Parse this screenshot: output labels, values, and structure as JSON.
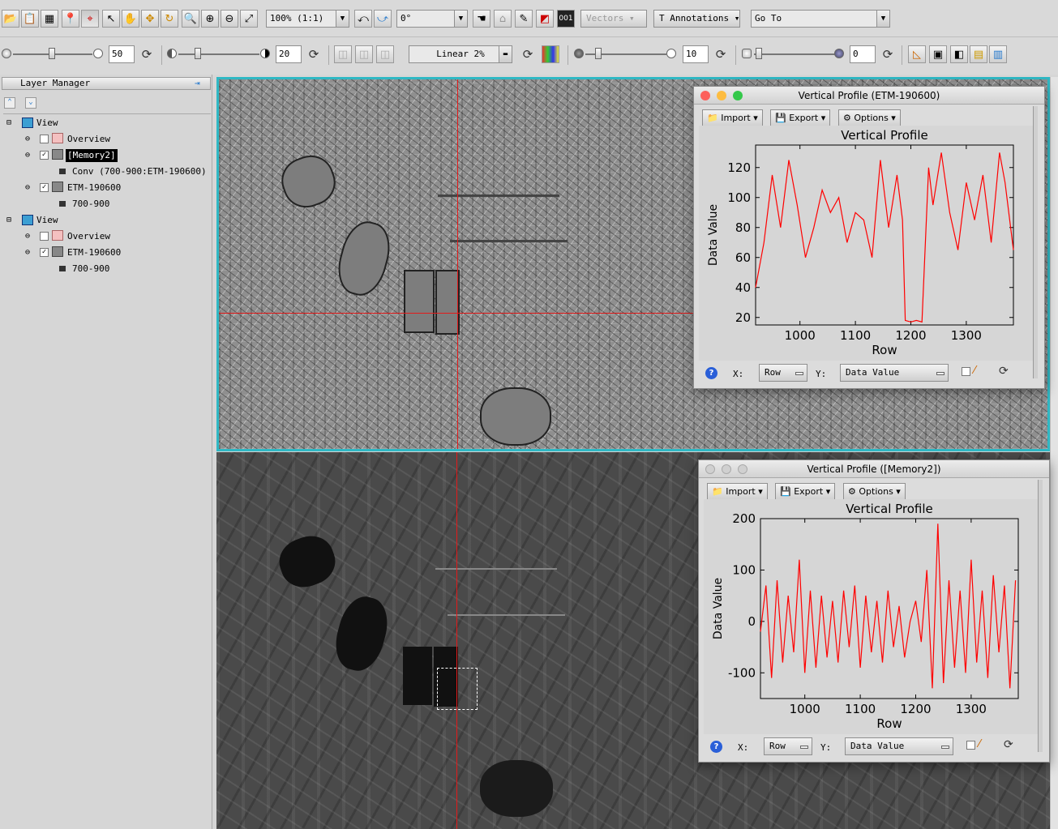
{
  "toolbar": {
    "zoom": "100% (1:1)",
    "rotation": "0°",
    "vectors_label": "Vectors",
    "annotations_label": "Annotations",
    "goto": "Go To",
    "stretch": "Linear 2%",
    "brightness": "50",
    "contrast": "20",
    "sharpen": "10",
    "transparency": "0"
  },
  "layer_manager": {
    "title": "Layer Manager",
    "tree": [
      {
        "label": "View"
      },
      {
        "label": "Overview"
      },
      {
        "label": "[Memory2]"
      },
      {
        "label": "Conv (700-900:ETM-190600)"
      },
      {
        "label": "ETM-190600"
      },
      {
        "label": "700-900"
      },
      {
        "label": "View"
      },
      {
        "label": "Overview"
      },
      {
        "label": "ETM-190600"
      },
      {
        "label": "700-900"
      }
    ]
  },
  "profiles": [
    {
      "title": "Vertical Profile (ETM-190600)",
      "import": "Import",
      "export": "Export",
      "options": "Options",
      "x_label": "X:",
      "x_value": "Row",
      "y_label": "Y:",
      "y_value": "Data Value",
      "chart_data": {
        "type": "line",
        "title": "Vertical Profile",
        "xlabel": "Row",
        "ylabel": "Data Value",
        "xlim": [
          920,
          1385
        ],
        "ylim": [
          15,
          135
        ],
        "xticks": [
          1000,
          1100,
          1200,
          1300
        ],
        "yticks": [
          20,
          40,
          60,
          80,
          100,
          120
        ],
        "color": "#ff0000",
        "x": [
          920,
          935,
          950,
          965,
          980,
          995,
          1010,
          1025,
          1040,
          1055,
          1070,
          1085,
          1100,
          1115,
          1130,
          1145,
          1160,
          1175,
          1185,
          1190,
          1200,
          1210,
          1220,
          1232,
          1240,
          1255,
          1270,
          1285,
          1300,
          1315,
          1330,
          1345,
          1360,
          1370,
          1385
        ],
        "y": [
          40,
          70,
          115,
          80,
          125,
          95,
          60,
          80,
          105,
          90,
          100,
          70,
          90,
          85,
          60,
          125,
          80,
          115,
          85,
          18,
          17,
          18,
          17,
          120,
          95,
          130,
          90,
          65,
          110,
          85,
          115,
          70,
          130,
          110,
          65
        ]
      }
    },
    {
      "title": "Vertical Profile ([Memory2])",
      "import": "Import",
      "export": "Export",
      "options": "Options",
      "x_label": "X:",
      "x_value": "Row",
      "y_label": "Y:",
      "y_value": "Data Value",
      "chart_data": {
        "type": "line",
        "title": "Vertical Profile",
        "xlabel": "Row",
        "ylabel": "Data Value",
        "xlim": [
          920,
          1385
        ],
        "ylim": [
          -150,
          200
        ],
        "xticks": [
          1000,
          1100,
          1200,
          1300
        ],
        "yticks": [
          -100,
          0,
          100,
          200
        ],
        "color": "#ff0000",
        "x": [
          920,
          930,
          940,
          950,
          960,
          970,
          980,
          990,
          1000,
          1010,
          1020,
          1030,
          1040,
          1050,
          1060,
          1070,
          1080,
          1090,
          1100,
          1110,
          1120,
          1130,
          1140,
          1150,
          1160,
          1170,
          1180,
          1190,
          1200,
          1210,
          1220,
          1230,
          1240,
          1250,
          1260,
          1270,
          1280,
          1290,
          1300,
          1310,
          1320,
          1330,
          1340,
          1350,
          1360,
          1370,
          1380
        ],
        "y": [
          -20,
          70,
          -110,
          80,
          -80,
          50,
          -60,
          120,
          -100,
          60,
          -90,
          50,
          -70,
          40,
          -80,
          60,
          -50,
          70,
          -90,
          50,
          -60,
          40,
          -80,
          60,
          -50,
          30,
          -70,
          0,
          40,
          -40,
          100,
          -130,
          190,
          -120,
          80,
          -90,
          60,
          -100,
          120,
          -80,
          60,
          -110,
          90,
          -60,
          70,
          -130,
          80
        ]
      }
    }
  ]
}
